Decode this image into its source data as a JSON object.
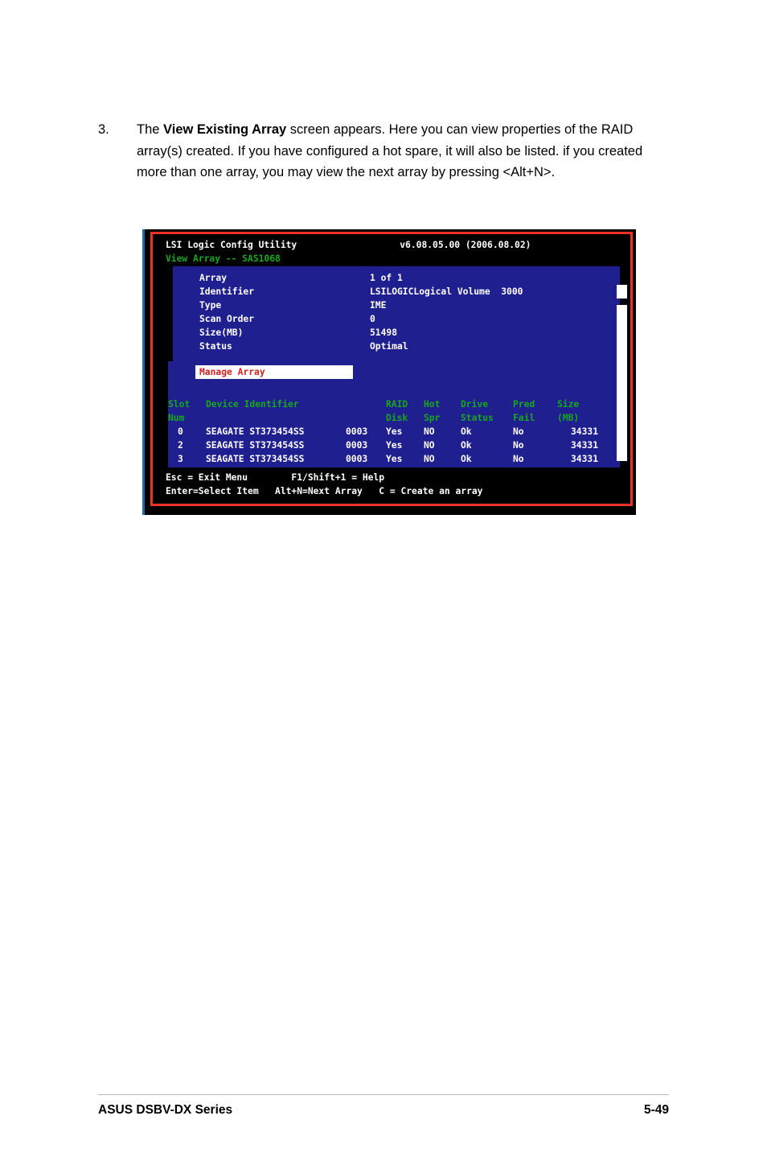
{
  "page": {
    "step_number": "3.",
    "instruction_parts": {
      "before_bold": "The ",
      "bold": "View Existing Array",
      "after_bold": " screen appears. Here you can view properties of the RAID array(s) created. If you have configured a hot spare, it will also be listed. if you created more than one array, you may view the next array by pressing <Alt+N>."
    },
    "footer_left": "ASUS DSBV-DX Series",
    "footer_right": "5-49"
  },
  "bios": {
    "title": "LSI Logic Config Utility",
    "version": "v6.08.05.00 (2006.08.02)",
    "subtitle": "View Array -- SAS1068",
    "properties": [
      {
        "label": "Array",
        "value": "1 of 1"
      },
      {
        "label": "Identifier",
        "value": "LSILOGICLogical Volume  3000"
      },
      {
        "label": "Type",
        "value": "IME"
      },
      {
        "label": "Scan Order",
        "value": "0"
      },
      {
        "label": "Size(MB)",
        "value": "51498"
      },
      {
        "label": "Status",
        "value": "Optimal"
      }
    ],
    "manage_array_label": "Manage Array",
    "table": {
      "header_line1": [
        "Slot",
        "Device Identifier",
        "",
        "RAID",
        "Hot",
        "Drive",
        "Pred",
        "Size"
      ],
      "header_line2": [
        "Num",
        "",
        "",
        "Disk",
        "Spr",
        "Status",
        "Fail",
        "(MB)"
      ],
      "rows": [
        {
          "slot": "0",
          "device": "SEAGATE ST373454SS",
          "fw": "0003",
          "raid_disk": "Yes",
          "hot_spr": "NO",
          "drive_status": "Ok",
          "pred_fail": "No",
          "size_mb": "34331"
        },
        {
          "slot": "2",
          "device": "SEAGATE ST373454SS",
          "fw": "0003",
          "raid_disk": "Yes",
          "hot_spr": "NO",
          "drive_status": "Ok",
          "pred_fail": "No",
          "size_mb": "34331"
        },
        {
          "slot": "3",
          "device": "SEAGATE ST373454SS",
          "fw": "0003",
          "raid_disk": "Yes",
          "hot_spr": "NO",
          "drive_status": "Ok",
          "pred_fail": "No",
          "size_mb": "34331"
        }
      ]
    },
    "help_line_1": "Esc = Exit Menu        F1/Shift+1 = Help",
    "help_line_2": "Enter=Select Item   Alt+N=Next Array   C = Create an array",
    "colors": {
      "panel_blue": "#1f1f8f",
      "accent_green": "#17a81a",
      "frame_red": "#ee3124",
      "highlight_red_text": "#d02020",
      "background_black": "#000000"
    }
  }
}
